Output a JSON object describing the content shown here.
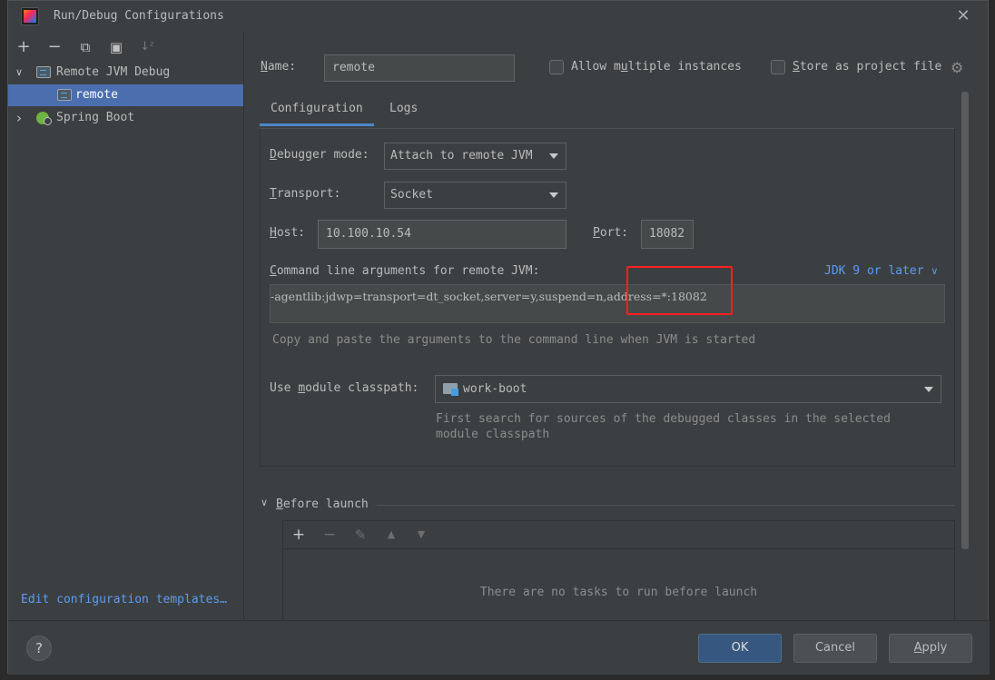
{
  "window": {
    "title": "Run/Debug Configurations",
    "close_glyph": "✕"
  },
  "left_toolbar": {
    "add": "+",
    "remove": "−",
    "copy": "⧉",
    "folder": "▣",
    "sort": "↓ᶻ"
  },
  "tree": {
    "remote_jvm_debug": "Remote JVM Debug",
    "remote": "remote",
    "spring_boot": "Spring Boot",
    "expanded_arrow": "∨",
    "collapsed_arrow": "›"
  },
  "edit_templates_link": "Edit configuration templates…",
  "name_field": {
    "label_pre": "",
    "label_mnemonic": "N",
    "label_post": "ame:",
    "value": "remote"
  },
  "allow_multiple": {
    "pre": "Allow m",
    "mnemonic": "u",
    "post": "ltiple instances"
  },
  "store_as_project": {
    "pre": "",
    "mnemonic": "S",
    "post": "tore as project file"
  },
  "tabs": [
    {
      "label": "Configuration"
    },
    {
      "label": "Logs"
    }
  ],
  "debugger_mode": {
    "label_pre": "",
    "label_mnemonic": "D",
    "label_post": "ebugger mode:",
    "value": "Attach to remote JVM"
  },
  "transport": {
    "label_pre": "",
    "label_mnemonic": "T",
    "label_post": "ransport:",
    "value": "Socket"
  },
  "host": {
    "label_pre": "",
    "label_mnemonic": "H",
    "label_post": "ost:",
    "value": "10.100.10.54"
  },
  "port": {
    "label_pre": "",
    "label_mnemonic": "P",
    "label_post": "ort:",
    "value": "18082"
  },
  "cmdline": {
    "label_pre": "",
    "label_mnemonic": "C",
    "label_post": "ommand line arguments for remote JVM:",
    "jdk_link": "JDK 9 or later",
    "jdk_chevron": "∨",
    "value": "-agentlib:jdwp=transport=dt_socket,server=y,suspend=n,address=*:18082",
    "hint": "Copy and paste the arguments to the command line when JVM is started"
  },
  "module_classpath": {
    "label_pre": "Use ",
    "label_mnemonic": "m",
    "label_post": "odule classpath:",
    "value": "work-boot",
    "hint_line1": "First search for sources of the debugged classes in the selected",
    "hint_line2": "module classpath"
  },
  "before_launch": {
    "chevron": "∨",
    "title_pre": "",
    "title_mnemonic": "B",
    "title_post": "efore launch",
    "add": "+",
    "remove": "−",
    "edit": "✎",
    "up": "▲",
    "down": "▼",
    "empty_text": "There are no tasks to run before launch"
  },
  "buttons": {
    "help": "?",
    "ok": "OK",
    "cancel": "Cancel",
    "apply_mnemonic": "A",
    "apply_post": "pply"
  },
  "colors": {
    "selection": "#4b6eaf",
    "link": "#589df6",
    "highlight_box": "#ff1f1f",
    "primary_button": "#365880"
  }
}
